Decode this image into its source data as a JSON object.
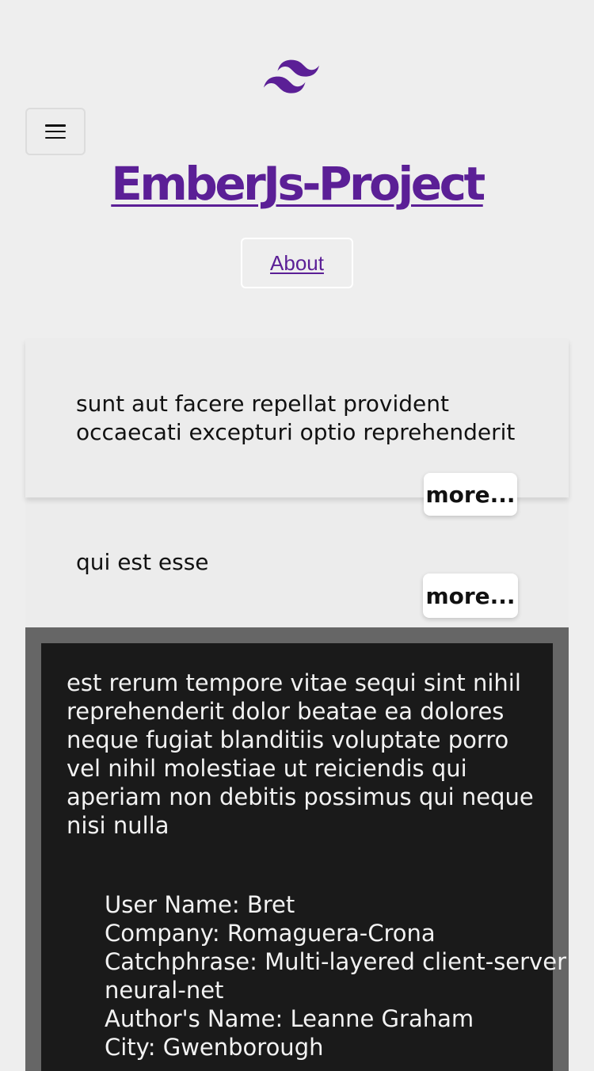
{
  "header": {
    "logo_icon": "tailwind-wave-icon",
    "menu_icon": "hamburger-menu-icon",
    "site_title": "EmberJs-Project",
    "nav": {
      "about_label": "About"
    },
    "accent_color": "#5b1f96"
  },
  "posts": [
    {
      "title": "sunt aut facere repellat provident occaecati excepturi optio reprehenderit",
      "more_label": "more..."
    },
    {
      "title": "qui est esse",
      "more_label": "more..."
    }
  ],
  "detail": {
    "body": "est rerum tempore vitae sequi sint nihil reprehenderit dolor beatae ea dolores neque fugiat blanditiis voluptate porro vel nihil molestiae ut reiciendis qui aperiam non debitis possimus qui neque nisi nulla",
    "user_name": "User Name: Bret",
    "company": "Company: Romaguera-Crona",
    "catchphrase": "Catchphrase: Multi-layered client-server neural-net",
    "author_name": "Author's Name: Leanne Graham",
    "city": "City: Gwenborough"
  }
}
